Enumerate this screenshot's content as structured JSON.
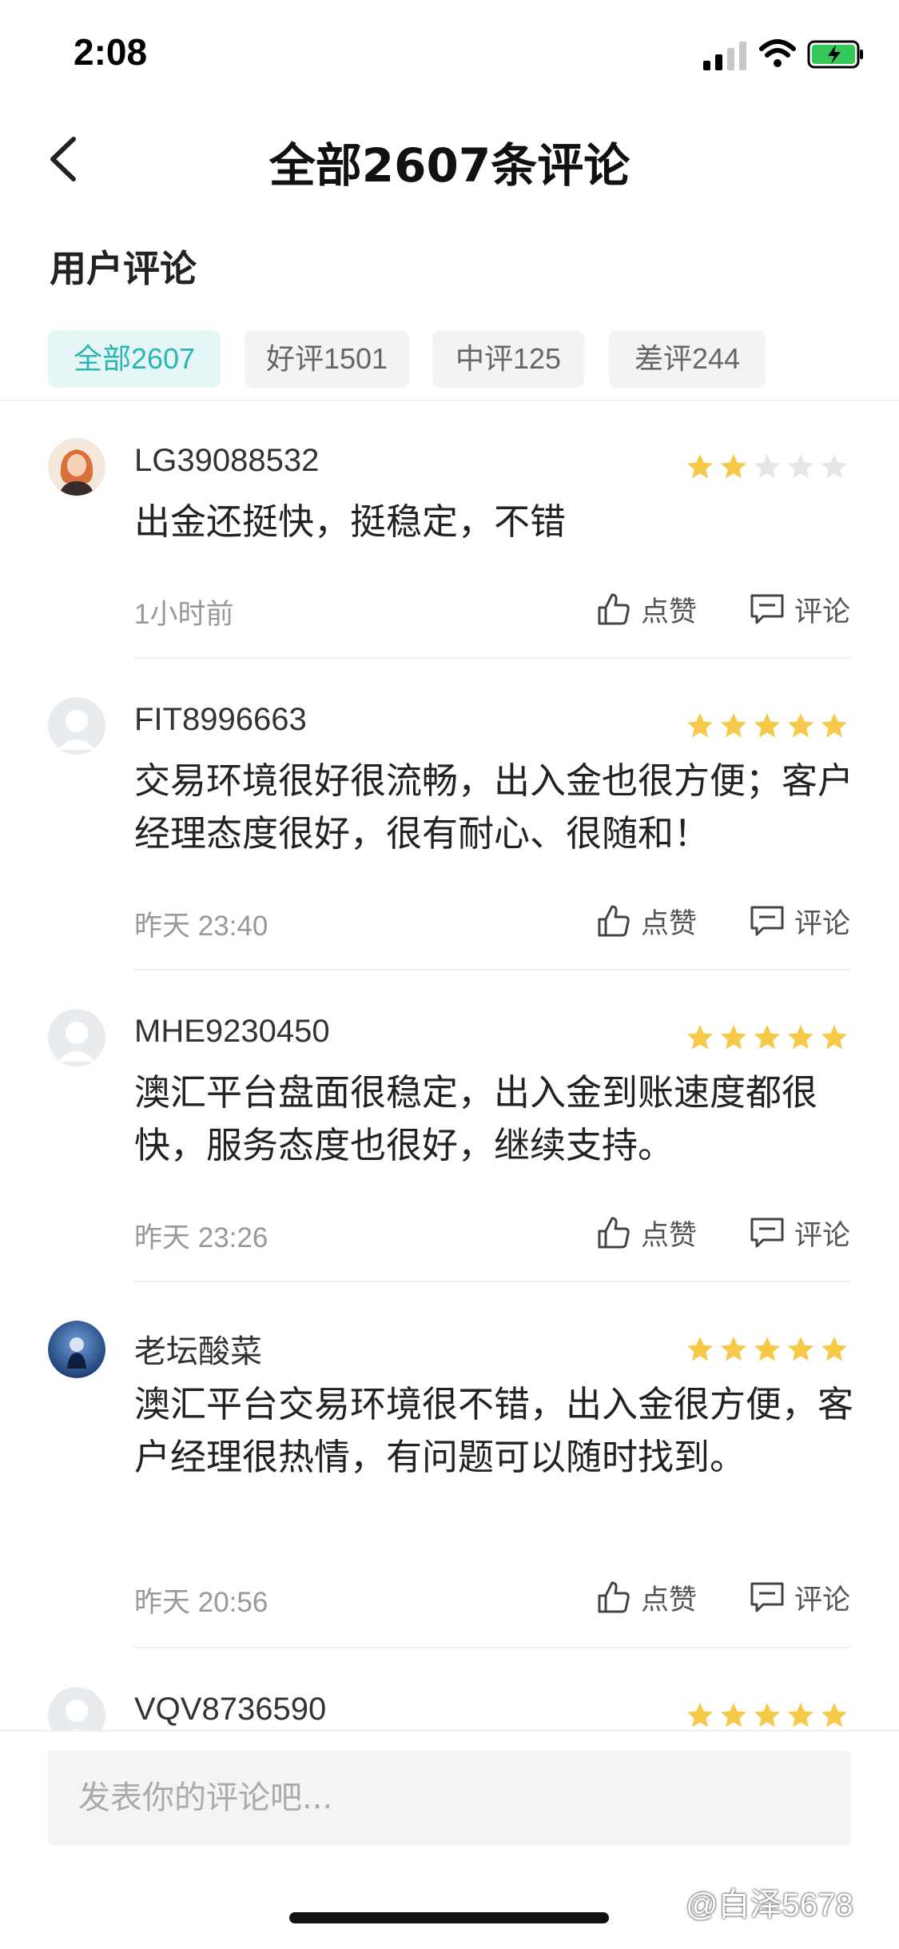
{
  "status_bar": {
    "time": "2:08"
  },
  "header": {
    "title": "全部2607条评论"
  },
  "section_title": "用户评论",
  "tabs": [
    {
      "label": "全部2607"
    },
    {
      "label": "好评1501"
    },
    {
      "label": "中评125"
    },
    {
      "label": "差评244"
    }
  ],
  "actions": {
    "like_label": "点赞",
    "comment_label": "评论"
  },
  "reviews": [
    {
      "username": "LG39088532",
      "rating": 2,
      "content": "出金还挺快，挺稳定，不错",
      "time": "1小时前"
    },
    {
      "username": "FIT8996663",
      "rating": 5,
      "content": "交易环境很好很流畅，出入金也很方便；客户经理态度很好，很有耐心、很随和！",
      "time": "昨天 23:40"
    },
    {
      "username": "MHE9230450",
      "rating": 5,
      "content": "澳汇平台盘面很稳定，出入金到账速度都很快，服务态度也很好，继续支持。",
      "time": "昨天 23:26"
    },
    {
      "username": "老坛酸菜",
      "rating": 5,
      "content": "澳汇平台交易环境很不错，出入金很方便，客户经理很热情，有问题可以随时找到。",
      "time": "昨天 20:56"
    },
    {
      "username": "VQV8736590",
      "rating": 5,
      "content": "",
      "time": ""
    }
  ],
  "comment_box": {
    "placeholder": "发表你的评论吧..."
  },
  "watermark": "@白泽5678",
  "colors": {
    "accent": "#2bb6b6",
    "star_on": "#f7c948",
    "star_off": "#e6e6e6"
  }
}
